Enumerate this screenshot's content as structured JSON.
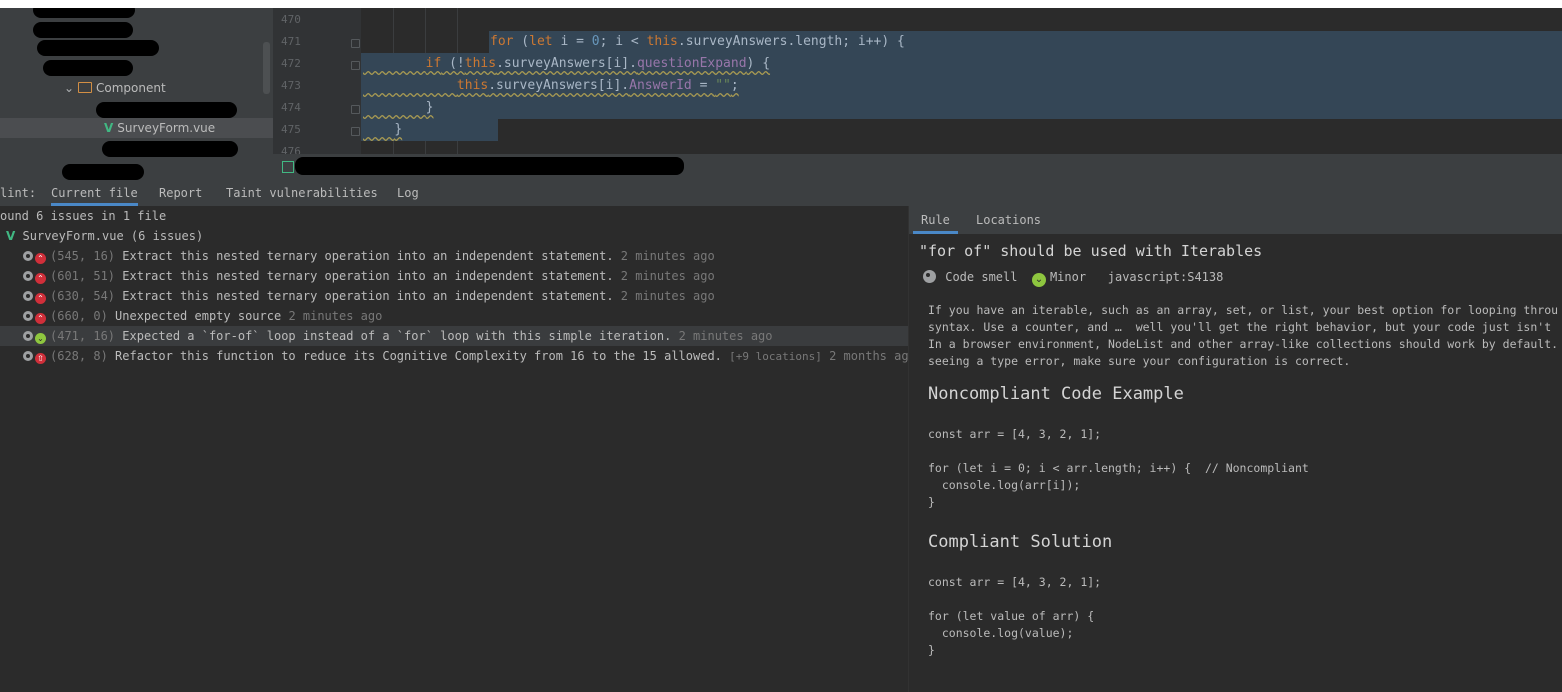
{
  "project_tree": {
    "folder_label": "Component",
    "selected_file": "SurveyForm.vue"
  },
  "editor": {
    "line_numbers": [
      "470",
      "471",
      "472",
      "473",
      "474",
      "475",
      "476"
    ],
    "code_lines": {
      "l471": {
        "kw1": "for",
        "p1": " (",
        "kw2": "let",
        "p2": " i = ",
        "n0": "0",
        "p3": "; i < ",
        "kw3": "this",
        "p4": ".surveyAnswers.length; i++) {"
      },
      "l472": {
        "kw1": "if",
        "p1": " (!",
        "kw2": "this",
        "p2": ".surveyAnswers[i].",
        "prop": "questionExpand",
        "p3": ") {"
      },
      "l473": {
        "kw1": "this",
        "p1": ".surveyAnswers[i].",
        "prop": "AnswerId",
        "p2": " = ",
        "str": "\"\"",
        "p3": ";"
      },
      "l474": "}",
      "l475": "}"
    }
  },
  "tabs": {
    "prefix": "lint:",
    "items": [
      "Current file",
      "Report",
      "Taint vulnerabilities",
      "Log"
    ]
  },
  "issues": {
    "summary": "ound 6 issues in 1 file",
    "file_label": "SurveyForm.vue",
    "file_count": "(6 issues)",
    "rows": [
      {
        "loc": "(545, 16)",
        "msg": "Extract this nested ternary operation into an independent statement.",
        "extra": "",
        "time": "2 minutes ago",
        "severity": "major"
      },
      {
        "loc": "(601, 51)",
        "msg": "Extract this nested ternary operation into an independent statement.",
        "extra": "",
        "time": "2 minutes ago",
        "severity": "major"
      },
      {
        "loc": "(630, 54)",
        "msg": "Extract this nested ternary operation into an independent statement.",
        "extra": "",
        "time": "2 minutes ago",
        "severity": "major"
      },
      {
        "loc": "(660, 0)",
        "msg": "Unexpected empty source",
        "extra": "",
        "time": "2 minutes ago",
        "severity": "major"
      },
      {
        "loc": "(471, 16)",
        "msg": "Expected a `for-of` loop instead of a `for` loop with this simple iteration.",
        "extra": "",
        "time": "2 minutes ago",
        "severity": "minor"
      },
      {
        "loc": "(628, 8)",
        "msg": "Refactor this function to reduce its Cognitive Complexity from 16 to the 15 allowed.",
        "extra": "[+9 locations]",
        "time": "2 months ago",
        "severity": "critical"
      }
    ]
  },
  "rule_panel": {
    "tabs": [
      "Rule",
      "Locations"
    ],
    "title": "\"for of\" should be used with Iterables",
    "type_label": "Code smell",
    "severity_label": "Minor",
    "rule_key": "javascript:S4138",
    "description": [
      "If you have an iterable, such as an array, set, or list, your best option for looping throu",
      "syntax. Use a counter, and …  well you'll get the right behavior, but your code just isn't",
      "In a browser environment, NodeList and other array-like collections should work by default.",
      "seeing a type error, make sure your configuration is correct."
    ],
    "noncompliant_heading": "Noncompliant Code Example",
    "noncompliant_code": [
      "const arr = [4, 3, 2, 1];",
      "",
      "for (let i = 0; i < arr.length; i++) {  // Noncompliant",
      "  console.log(arr[i]);",
      "}"
    ],
    "compliant_heading": "Compliant Solution",
    "compliant_code": [
      "const arr = [4, 3, 2, 1];",
      "",
      "for (let value of arr) {",
      "  console.log(value);",
      "}"
    ]
  },
  "colors": {
    "keyword": "#cc7832",
    "number": "#6897bb",
    "field": "#9876aa",
    "string": "#6a8759",
    "selection": "#344656",
    "severity_major": "#d02f3a",
    "severity_minor": "#8ec63f"
  }
}
